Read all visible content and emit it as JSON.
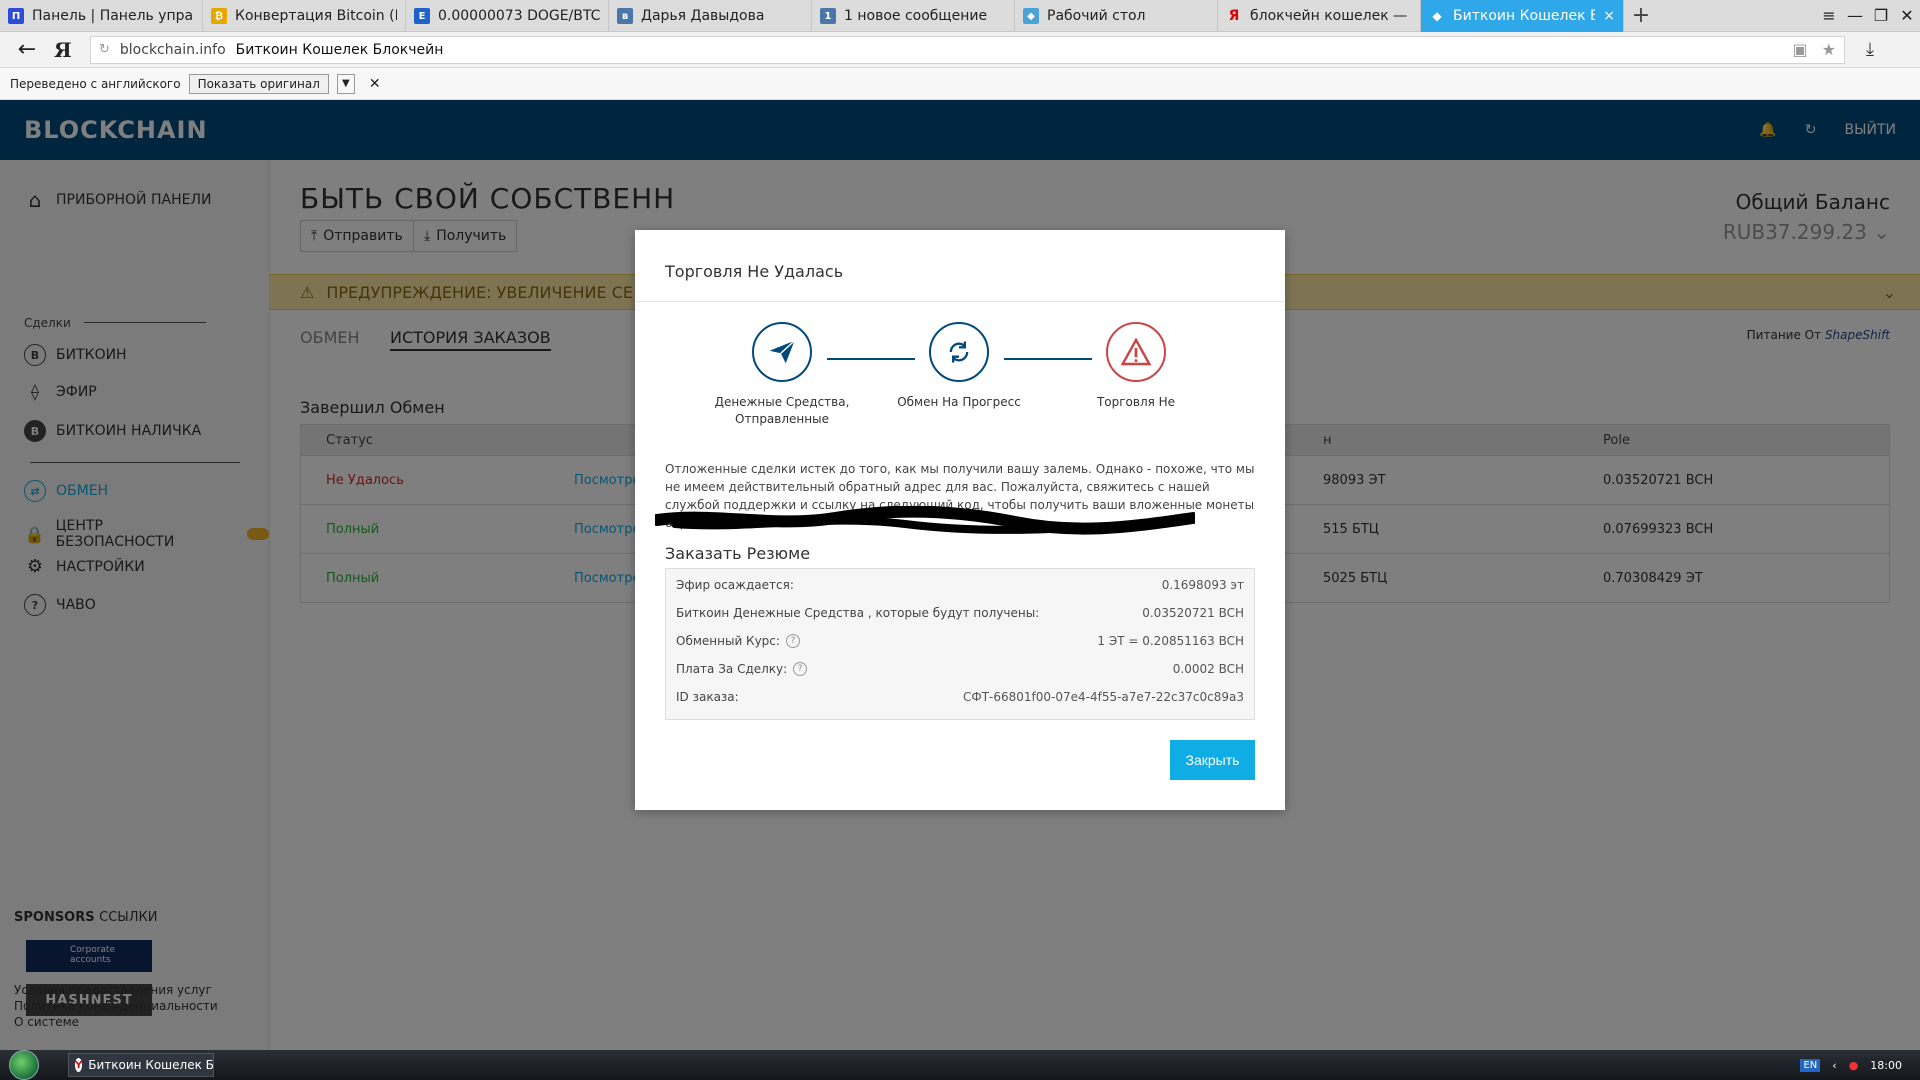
{
  "browser": {
    "tabs": [
      {
        "label": "Панель | Панель управления",
        "icon": "panel-icon",
        "color": "#2d4bd8",
        "glyph": "П"
      },
      {
        "label": "Конвертация Bitcoin (BTC) в",
        "icon": "convert-icon",
        "color": "#e6a800",
        "glyph": "₿"
      },
      {
        "label": "0.00000073 DOGE/BTC",
        "icon": "exchange-icon",
        "color": "#1f62c9",
        "glyph": "E"
      },
      {
        "label": "Дарья Давыдова",
        "icon": "vk-icon",
        "color": "#4a76a8",
        "glyph": "в"
      },
      {
        "label": "1 новое сообщение",
        "icon": "message-icon",
        "color": "#4a76a8",
        "glyph": "1"
      },
      {
        "label": "Рабочий стол",
        "icon": "desktop-icon",
        "color": "#4aa3d8",
        "glyph": "◆"
      },
      {
        "label": "блокчейн кошелек — Яндекс",
        "icon": "yandex-icon",
        "color": "#e00000",
        "glyph": "Я"
      },
      {
        "label": "Биткоин Кошелек Блокчейн",
        "icon": "blockchain-icon",
        "color": "#ffffff",
        "glyph": "◆",
        "active": true
      }
    ],
    "close_tab": "×",
    "new_tab": "+",
    "url_domain": "blockchain.info",
    "url_title": "Биткоин Кошелек Блокчейн",
    "translate_label": "Переведено с английского",
    "show_original": "Показать оригинал"
  },
  "header": {
    "logo": "BLOCKCHAIN",
    "logout": "ВЫЙТИ"
  },
  "sidebar": {
    "dashboard": "ПРИБОРНОЙ ПАНЕЛИ",
    "trades_label": "Сделки",
    "bitcoin": "БИТКОИН",
    "ether": "ЭФИР",
    "bitcoin_cash": "БИТКОИН НАЛИЧКА",
    "exchange": "ОБМЕН",
    "security": "ЦЕНТР БЕЗОПАСНОСТИ",
    "settings": "НАСТРОЙКИ",
    "faq": "ЧАВО",
    "sponsors_bold": "SPONSORS",
    "sponsors_rest": "ССЫЛКИ",
    "sponsor_corporate": "Corporate accounts",
    "sponsor_hashnest": "HASHNEST",
    "terms": "Условия предоставления услуг",
    "privacy": "Политика конфиденциальности",
    "about": "О системе"
  },
  "main": {
    "title": "БЫТЬ СВОЙ СОБСТВЕНН",
    "send": "Отправить",
    "receive": "Получить",
    "balance_label": "Общий Баланс",
    "balance_value": "RUB37.299.23",
    "warning": "ПРЕДУПРЕЖДЕНИЕ: УВЕЛИЧЕНИЕ СЕ",
    "tab_exchange": "ОБМЕН",
    "tab_history": "ИСТОРИЯ ЗАКАЗОВ",
    "powered_by": "Питание От",
    "powered_brand": "ShapeShift",
    "section_title": "Завершил Обмен",
    "columns": [
      "Статус",
      "",
      "н",
      "Pole"
    ],
    "rows": [
      {
        "status": "Не Удалось",
        "status_type": "fail",
        "view": "Посмотре",
        "amount": "98093 ЭТ",
        "pole": "0.03520721 BCH"
      },
      {
        "status": "Полный",
        "status_type": "ok",
        "view": "Посмотре",
        "amount": "515 БТЦ",
        "pole": "0.07699323 BCH"
      },
      {
        "status": "Полный",
        "status_type": "ok",
        "view": "Посмотре",
        "amount": "5025 БТЦ",
        "pole": "0.70308429 ЭТ"
      }
    ]
  },
  "modal": {
    "title": "Торговля Не Удалась",
    "steps": [
      {
        "label_line1": "Денежные Средства,",
        "label_line2": "Отправленные",
        "icon": "send-plane-icon"
      },
      {
        "label_line1": "Обмен На Прогресс",
        "label_line2": "",
        "icon": "exchange-progress-icon"
      },
      {
        "label_line1": "Торговля Не",
        "label_line2": "",
        "icon": "warning-triangle-icon"
      }
    ],
    "text": "Отложенные сделки истек до того, как мы получили вашу залемь. Однако - похоже, что мы не имеем действительный обратный адрес для вас. Пожалуйста, свяжитесь с нашей службой поддержки и ссылку на следующий код, чтобы получить ваши вложенные монеты обратно:",
    "summary_title": "Заказать Резюме",
    "summary": [
      {
        "label": "Эфир осаждается:",
        "value": "0.1698093 эт",
        "help": false
      },
      {
        "label": "Биткоин Денежные Средства , которые будут получены:",
        "value": "0.03520721 BCH",
        "help": false
      },
      {
        "label": "Обменный Курс:",
        "value": "1 ЭТ = 0.20851163 BCH",
        "help": true
      },
      {
        "label": "Плата За Сделку:",
        "value": "0.0002 BCH",
        "help": true
      },
      {
        "label": "ID заказа:",
        "value": "СФТ-66801f00-07e4-4f55-a7e7-22c37c0c89a3",
        "help": false
      }
    ],
    "close": "Закрыть"
  },
  "taskbar": {
    "task": "Биткоин Кошелек Б...",
    "lang": "EN",
    "time": "18:00"
  },
  "colors": {
    "brand": "#004a7c",
    "accent": "#10ADE4",
    "fail": "#d0282b",
    "ok": "#2bb33c"
  }
}
